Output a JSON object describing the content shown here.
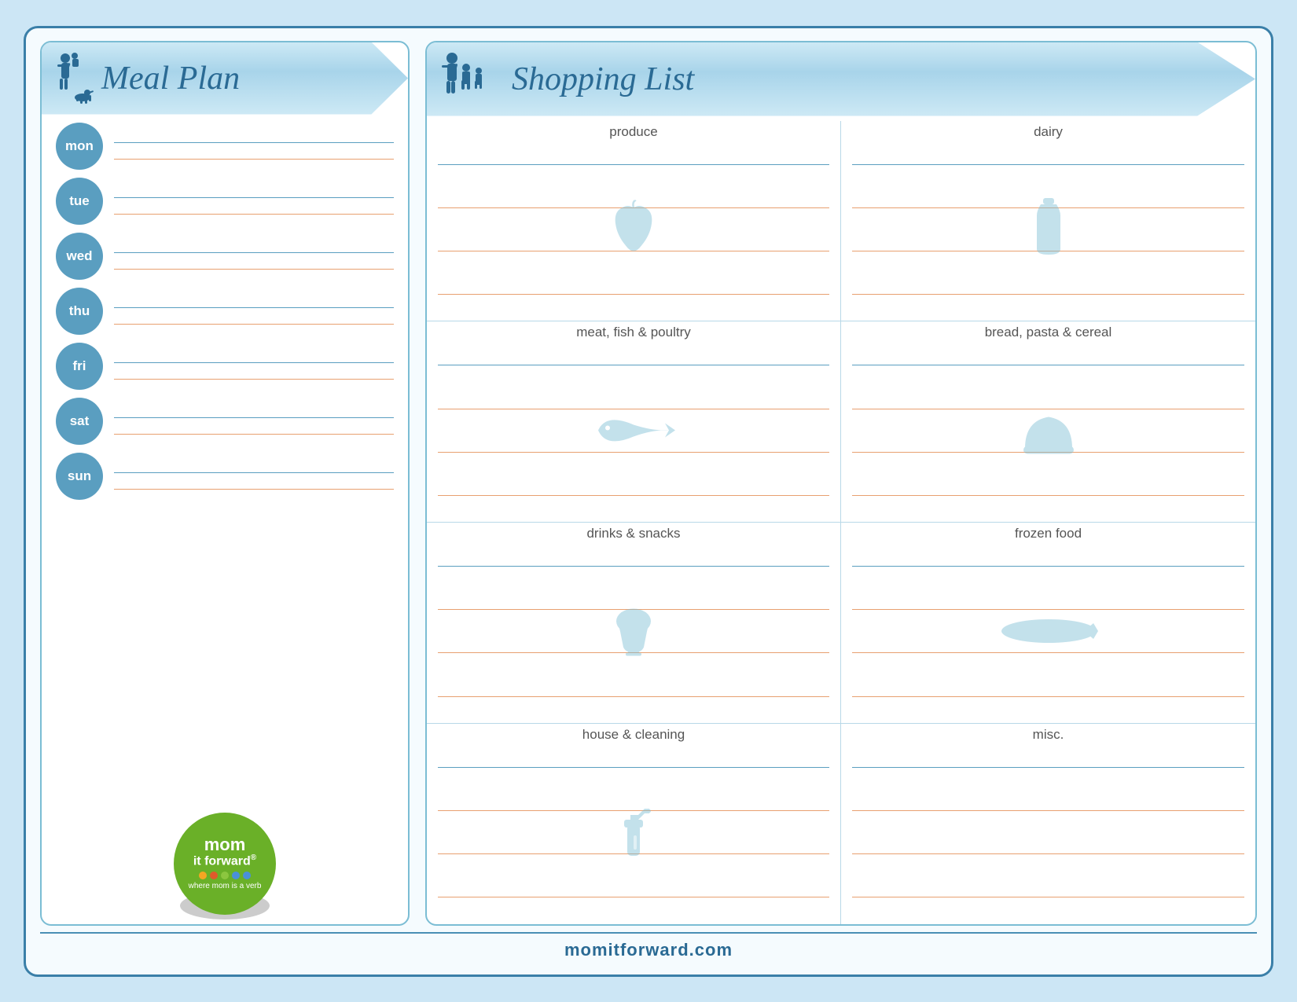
{
  "page": {
    "background_color": "#e0f0f8",
    "border_color": "#2a6a94",
    "footer_url": "momitforward.com"
  },
  "meal_plan": {
    "title": "Meal Plan",
    "days": [
      {
        "label": "mon"
      },
      {
        "label": "tue"
      },
      {
        "label": "wed"
      },
      {
        "label": "thu"
      },
      {
        "label": "fri"
      },
      {
        "label": "sat"
      },
      {
        "label": "sun"
      }
    ]
  },
  "shopping_list": {
    "title": "Shopping List",
    "sections_left": [
      {
        "title": "produce",
        "icon": "apple"
      },
      {
        "title": "meat, fish & poultry",
        "icon": "fish"
      },
      {
        "title": "drinks & snacks",
        "icon": "cupcake"
      },
      {
        "title": "house & cleaning",
        "icon": "spray"
      }
    ],
    "sections_right": [
      {
        "title": "dairy",
        "icon": "bottle"
      },
      {
        "title": "bread, pasta & cereal",
        "icon": "bread"
      },
      {
        "title": "frozen food",
        "icon": "fish-flat"
      },
      {
        "title": "misc.",
        "icon": "misc"
      }
    ]
  },
  "logo": {
    "line1": "mom",
    "line2": "it forward",
    "registered": "®",
    "tagline": "where mom is a verb",
    "dots": [
      "#f5a623",
      "#e05a2b",
      "#6ab028",
      "#5b9ec0",
      "#5b9ec0"
    ]
  },
  "footer": {
    "text": "momitforward.com"
  }
}
